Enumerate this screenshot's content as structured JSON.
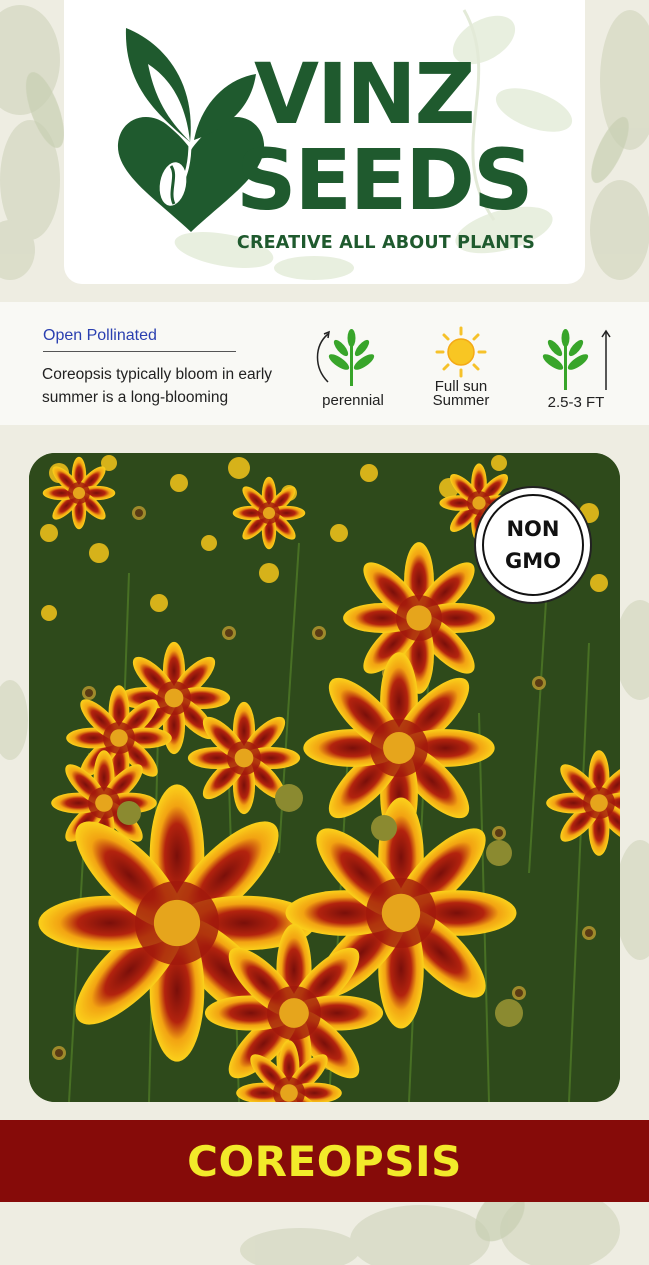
{
  "brand": {
    "line1": "VINZ",
    "line2": "SEEDS",
    "tagline": "CREATIVE ALL ABOUT PLANTS",
    "color": "#1f5a2e"
  },
  "info": {
    "pollination": "Open Pollinated",
    "description": "Coreopsis typically bloom in early summer is a long-blooming",
    "attributes": [
      {
        "icon": "perennial-plant-icon",
        "label": "perennial"
      },
      {
        "icon": "sun-icon",
        "label_line1": "Full sun",
        "label_line2": "Summer"
      },
      {
        "icon": "plant-height-icon",
        "label": "2.5-3 FT"
      }
    ]
  },
  "badge": {
    "line1": "NON",
    "line2": "GMO"
  },
  "product": {
    "name": "COREOPSIS",
    "band_color": "#860b09",
    "text_color": "#f2ea2a"
  }
}
